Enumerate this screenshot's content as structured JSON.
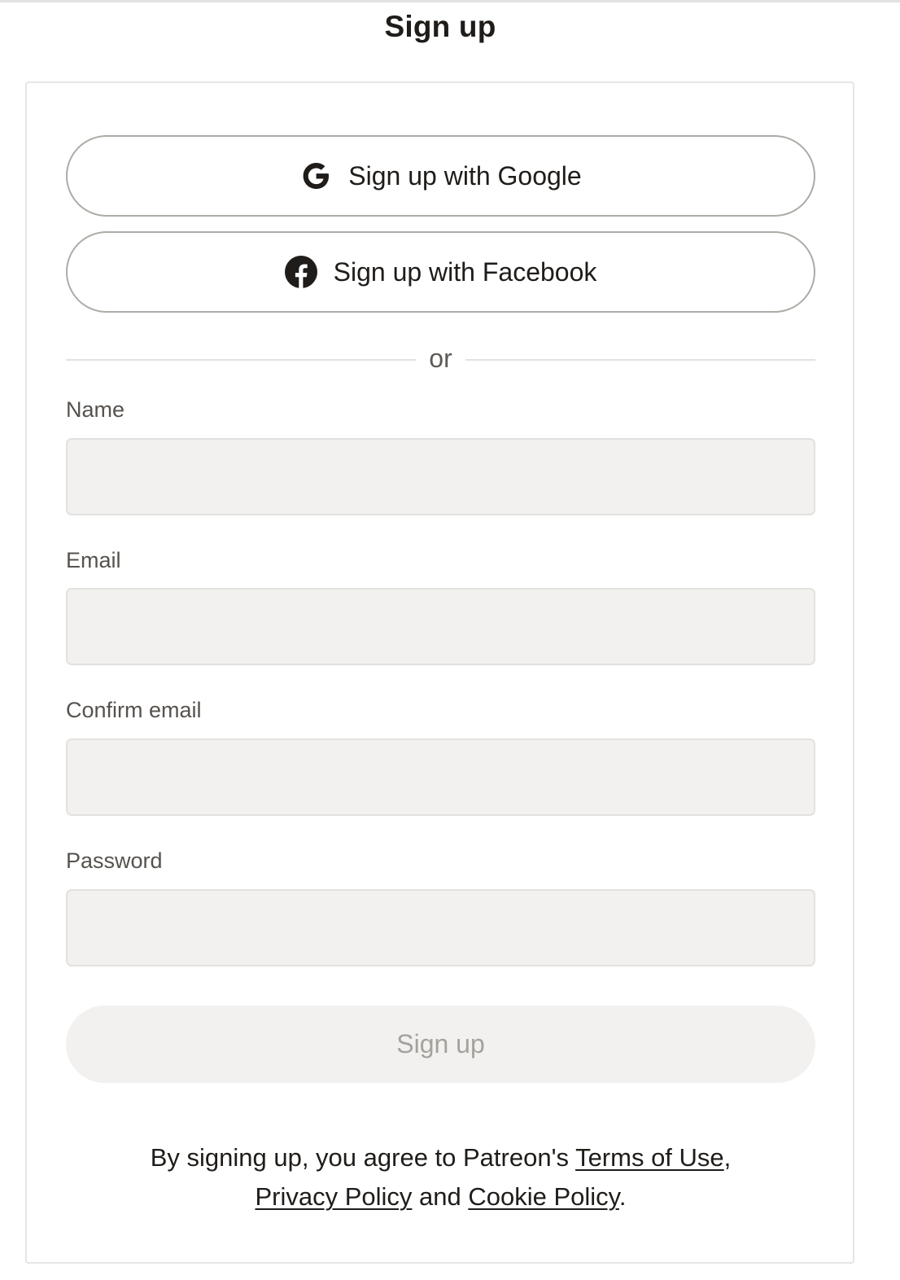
{
  "page": {
    "title": "Sign up"
  },
  "oauth": {
    "google": {
      "label": "Sign up with Google",
      "icon": "google-g-icon"
    },
    "facebook": {
      "label": "Sign up with Facebook",
      "icon": "facebook-icon"
    }
  },
  "divider": {
    "text": "or"
  },
  "form": {
    "name": {
      "label": "Name",
      "value": "",
      "placeholder": ""
    },
    "email": {
      "label": "Email",
      "value": "",
      "placeholder": ""
    },
    "confirm_email": {
      "label": "Confirm email",
      "value": "",
      "placeholder": ""
    },
    "password": {
      "label": "Password",
      "value": "",
      "placeholder": ""
    },
    "submit_label": "Sign up"
  },
  "legal": {
    "prefix": "By signing up, you agree to Patreon's ",
    "terms": "Terms of Use",
    "comma": ",",
    "privacy": "Privacy Policy",
    "and": " and ",
    "cookie": "Cookie Policy",
    "period": "."
  },
  "colors": {
    "text": "#1f1c19",
    "input_bg": "#f2f1ef",
    "button_border": "#aeaba6",
    "disabled_text": "#a5a29d"
  }
}
